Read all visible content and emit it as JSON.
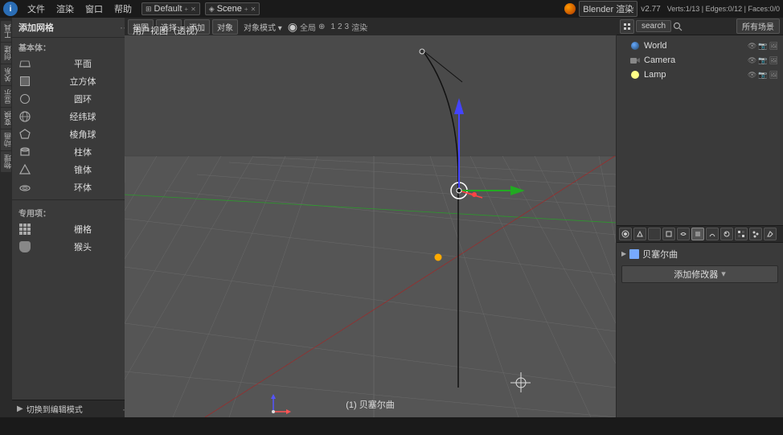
{
  "topbar": {
    "icon": "i",
    "menus": [
      "文件",
      "渲染",
      "窗口",
      "帮助"
    ],
    "workspace_icon": "grid",
    "workspace": "Default",
    "scene_icon": "scene",
    "scene": "Scene",
    "engine": "Blender 渲染",
    "version": "v2.77",
    "stats": "Verts:1/13 | Edges:0/12 | Faces:0/0"
  },
  "left_panel": {
    "title": "添加网格",
    "basic_label": "基本体：",
    "items": [
      {
        "label": "平面",
        "icon": "plane"
      },
      {
        "label": "立方体",
        "icon": "cube"
      },
      {
        "label": "圆环",
        "icon": "circle"
      },
      {
        "label": "经纬球",
        "icon": "uvsphere"
      },
      {
        "label": "棱角球",
        "icon": "icosphere"
      },
      {
        "label": "柱体",
        "icon": "cylinder"
      },
      {
        "label": "锥体",
        "icon": "cone"
      },
      {
        "label": "环体",
        "icon": "torus"
      }
    ],
    "special_label": "专用项：",
    "special_items": [
      {
        "label": "栅格",
        "icon": "grid"
      },
      {
        "label": "猴头",
        "icon": "monkey"
      }
    ],
    "switch_mode": "切换到编辑模式"
  },
  "viewport": {
    "label": "用户视图（透视）",
    "object_label": "(1) 贝塞尔曲"
  },
  "right_panel": {
    "top_toolbar": {
      "buttons": [
        "view",
        "search"
      ],
      "scene_btn": "所有场景"
    },
    "scene_items": [
      {
        "label": "World",
        "icon": "world"
      },
      {
        "label": "Camera",
        "icon": "camera"
      },
      {
        "label": "Lamp",
        "icon": "lamp"
      }
    ],
    "prop_section": {
      "name": "贝塞尔曲",
      "add_modifier_label": "添加修改器"
    }
  },
  "status_bar": {
    "text": ""
  }
}
